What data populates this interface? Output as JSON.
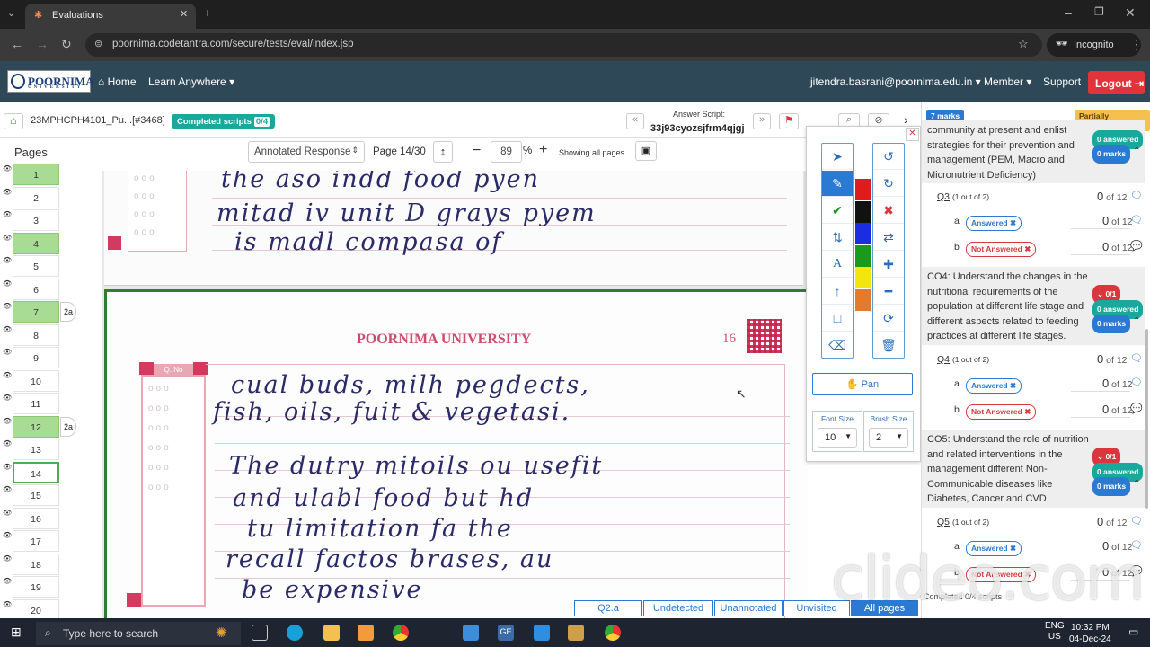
{
  "browser": {
    "tab_title": "Evaluations",
    "url": "poornima.codetantra.com/secure/tests/eval/index.jsp",
    "incognito_label": "Incognito"
  },
  "header": {
    "logo_text": "POORNIMA",
    "logo_sub": "UNIVERSITY",
    "nav_home": "Home",
    "nav_learn": "Learn Anywhere",
    "user_email": "jitendra.basrani@poornima.edu.in",
    "nav_member": "Member",
    "nav_support": "Support",
    "logout": "Logout"
  },
  "toolbar": {
    "script_name": "23MPHCPH4101_Pu...[#3468]",
    "completed_label": "Completed scripts",
    "completed_count": "0/4",
    "answer_script_label": "Answer Script:",
    "answer_script_id": "33j93cyozsjfrm4qjgj",
    "view_mode": "Annotated Response",
    "page_label": "Page 14/30",
    "zoom_value": "89",
    "zoom_unit": "%",
    "showing": "Showing all pages"
  },
  "pages": {
    "title": "Pages",
    "items": [
      {
        "n": "1",
        "state": "green"
      },
      {
        "n": "2",
        "state": ""
      },
      {
        "n": "3",
        "state": ""
      },
      {
        "n": "4",
        "state": "green"
      },
      {
        "n": "5",
        "state": ""
      },
      {
        "n": "6",
        "state": ""
      },
      {
        "n": "7",
        "state": "green",
        "tag": "2a"
      },
      {
        "n": "8",
        "state": ""
      },
      {
        "n": "9",
        "state": ""
      },
      {
        "n": "10",
        "state": ""
      },
      {
        "n": "11",
        "state": ""
      },
      {
        "n": "12",
        "state": "green",
        "tag": "2a"
      },
      {
        "n": "13",
        "state": ""
      },
      {
        "n": "14",
        "state": "cur"
      },
      {
        "n": "15",
        "state": ""
      },
      {
        "n": "16",
        "state": ""
      },
      {
        "n": "17",
        "state": ""
      },
      {
        "n": "18",
        "state": ""
      },
      {
        "n": "19",
        "state": ""
      },
      {
        "n": "20",
        "state": ""
      }
    ]
  },
  "document": {
    "top_lines": [
      "the aso indd food pyen",
      "mitad iv unit D grays pyem",
      "is madl compasa of"
    ],
    "university": "POORNIMA UNIVERSITY",
    "page_num": "16",
    "qno_label": "Q. No",
    "lines": [
      "cual buds, milh pegdects,",
      "fish, oils, fuit & vegetasi.",
      "The dutry mitoils ou usefit",
      "and ulabl food but hd",
      "tu limitation fa the",
      "recall factos brases, au",
      "be expensive"
    ]
  },
  "tools": {
    "pan_label": "Pan",
    "font_size_label": "Font Size",
    "font_size_value": "10",
    "brush_size_label": "Brush Size",
    "brush_size_value": "2",
    "colors": [
      "#e01b1b",
      "#111111",
      "#1a2ee0",
      "#1a9a1a",
      "#f3e60f",
      "#e57a2a"
    ]
  },
  "right_panel": {
    "marks_badge": "7 marks",
    "status_badge": "Partially corrected",
    "co_blocks": [
      {
        "text": "community at present and enlist strategies for their prevention and management (PEM, Macro and Micronutrient Deficiency)",
        "answered": "0 answered",
        "marks": "0 marks"
      },
      {
        "text": "CO4: Understand the changes in the nutritional requirements of the population at different life stage and different aspects related to feeding practices at different life stages.",
        "score": "0/1",
        "answered": "0 answered",
        "marks": "0 marks"
      },
      {
        "text": "CO5: Understand the role of nutrition and related interventions in the management different Non-Communicable diseases like Diabetes, Cancer and CVD",
        "score": "0/1",
        "answered": "0 answered",
        "marks": "0 marks"
      }
    ],
    "questions": [
      {
        "q": "Q3",
        "count": "(1 out of 2)",
        "score": "0",
        "of": "of 12",
        "a_status": "Answered",
        "a_score": "0",
        "a_of": "of 12",
        "b_status": "Not Answered",
        "b_score": "0",
        "b_of": "of 12"
      },
      {
        "q": "Q4",
        "count": "(1 out of 2)",
        "score": "0",
        "of": "of 12",
        "a_status": "Answered",
        "a_score": "0",
        "a_of": "of 12",
        "b_status": "Not Answered",
        "b_score": "0",
        "b_of": "of 12"
      },
      {
        "q": "Q5",
        "count": "(1 out of 2)",
        "score": "0",
        "of": "of 12",
        "a_status": "Answered",
        "a_score": "0",
        "a_of": "of 12",
        "b_status": "Not Answered",
        "b_score": "0",
        "b_of": "of 12"
      }
    ],
    "sub_a": "a",
    "sub_b": "b",
    "footer": "Completed 0/4 scripts"
  },
  "bottom_tabs": [
    "Q2.a",
    "Undetected",
    "Unannotated",
    "Unvisited",
    "All pages"
  ],
  "taskbar": {
    "search": "Type here to search",
    "lang1": "ENG",
    "lang2": "US",
    "time": "10:32 PM",
    "date": "04-Dec-24"
  },
  "watermark": "clideo.com"
}
